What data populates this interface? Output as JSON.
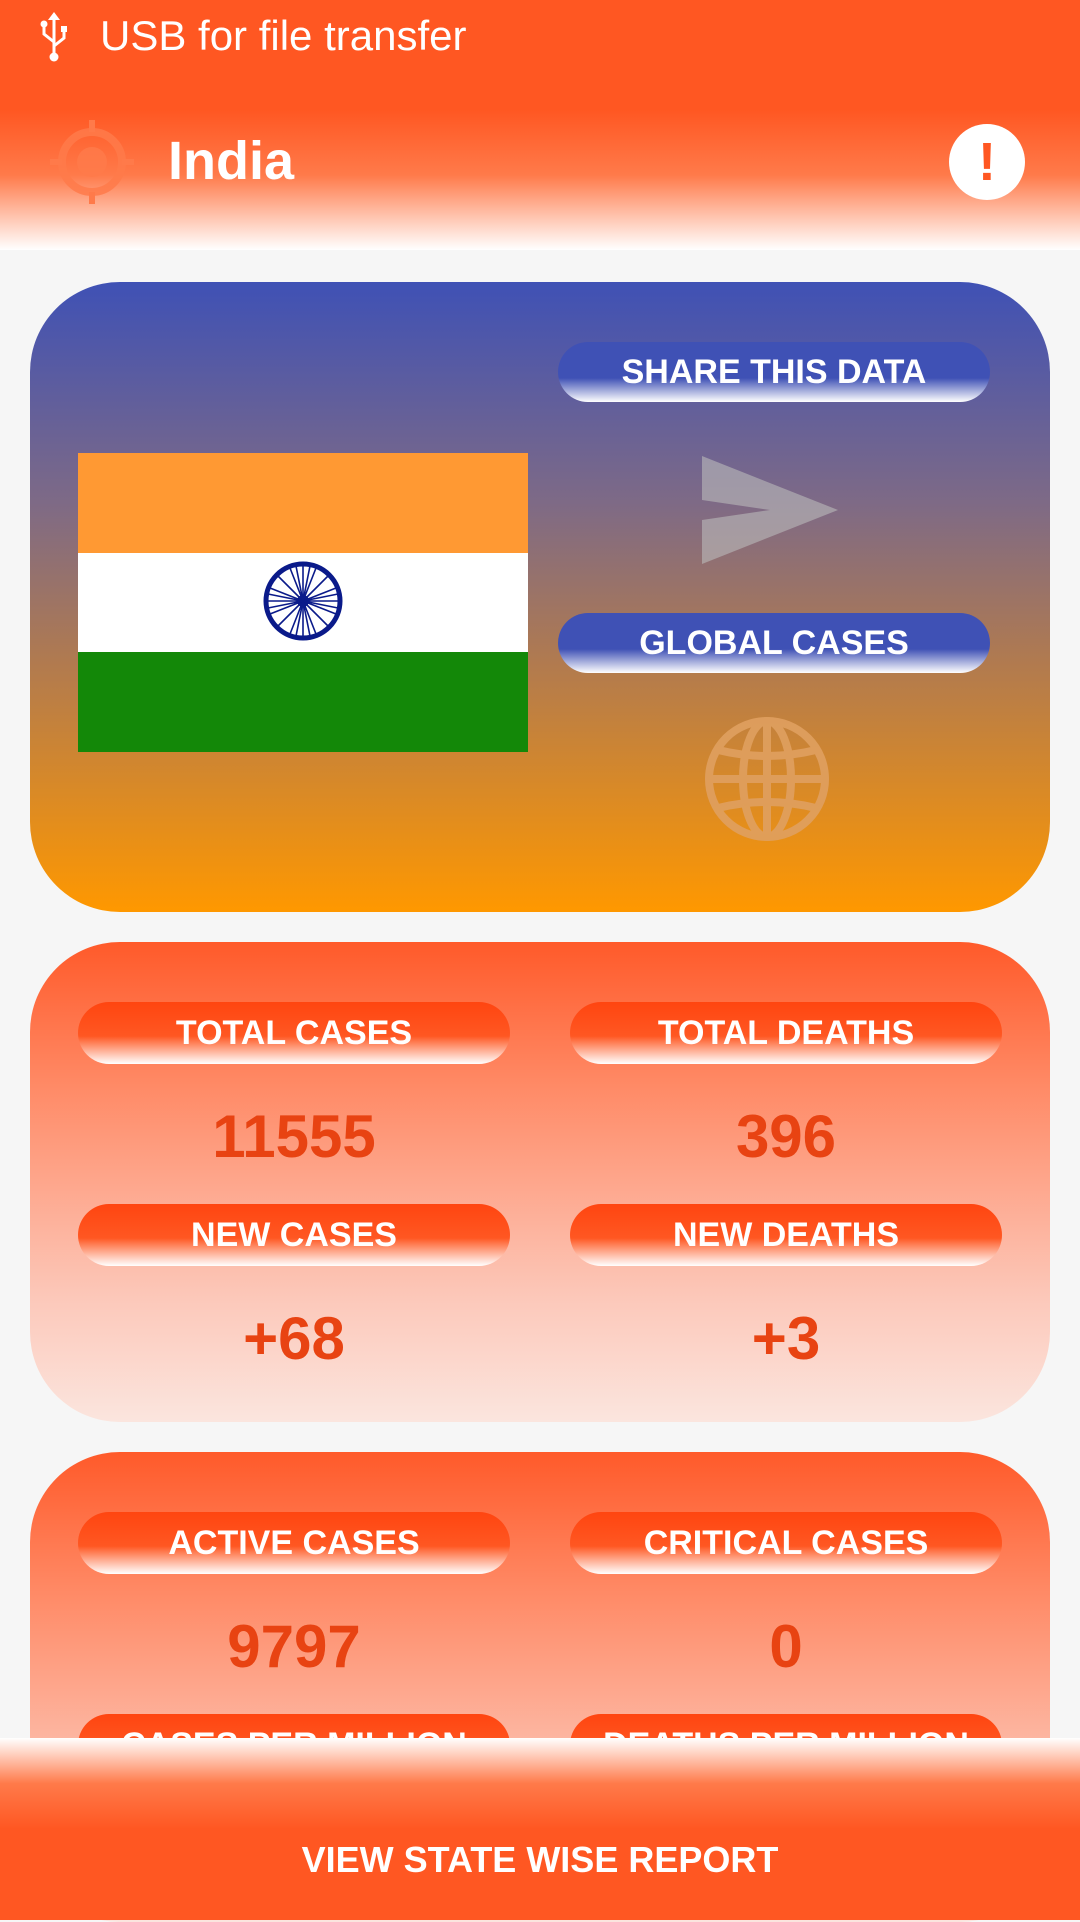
{
  "status_bar": {
    "text": "USB for file transfer"
  },
  "app_bar": {
    "title": "India"
  },
  "country_card": {
    "share_label": "SHARE THIS DATA",
    "global_label": "GLOBAL CASES"
  },
  "stats1": {
    "total_cases_label": "TOTAL CASES",
    "total_cases_value": "11555",
    "total_deaths_label": "TOTAL DEATHS",
    "total_deaths_value": "396",
    "new_cases_label": "NEW CASES",
    "new_cases_value": "+68",
    "new_deaths_label": "NEW DEATHS",
    "new_deaths_value": "+3"
  },
  "stats2": {
    "active_cases_label": "ACTIVE CASES",
    "active_cases_value": "9797",
    "critical_cases_label": "CRITICAL CASES",
    "critical_cases_value": "0",
    "cases_per_million_label": "CASES PER MILLION",
    "deaths_per_million_label": "DEATHS PER MILLION"
  },
  "bottom": {
    "button_label": "VIEW STATE WISE REPORT"
  },
  "colors": {
    "accent": "#ff5722",
    "blue": "#3f51b5",
    "value": "#e84312"
  }
}
